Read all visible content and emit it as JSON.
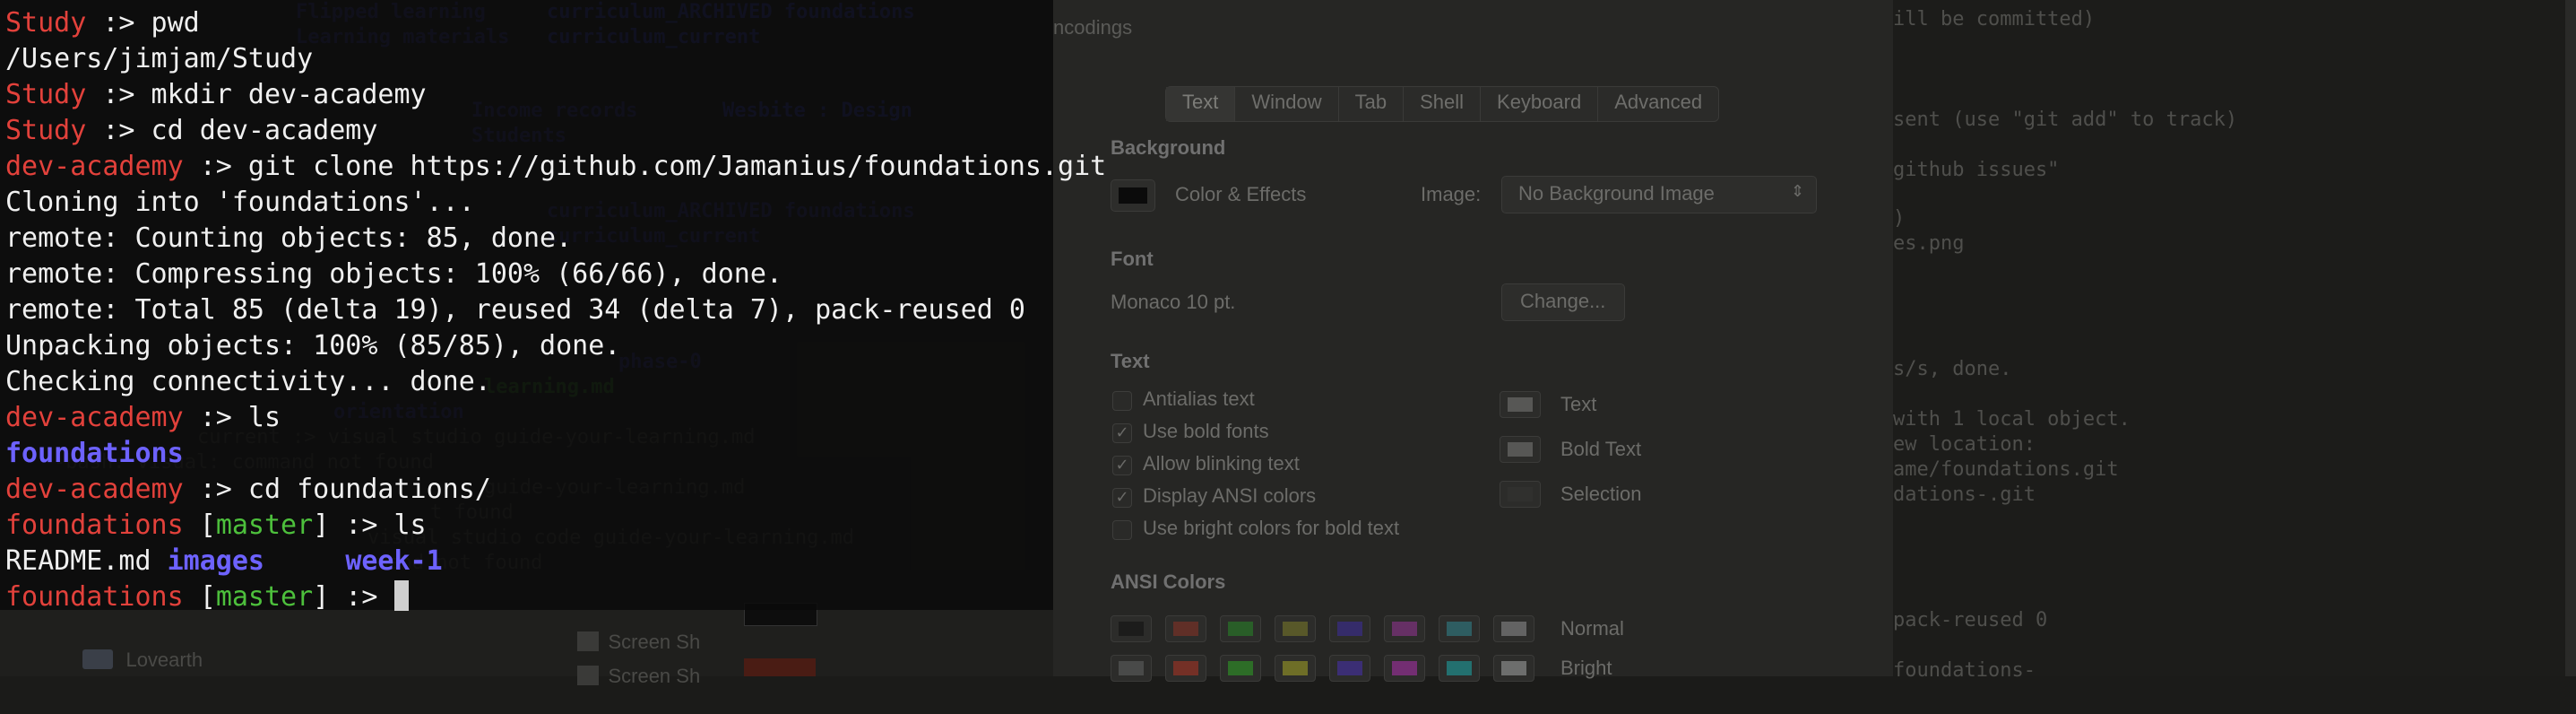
{
  "finder": {
    "rows": [
      {
        "a": "Flipped learning",
        "b": "curriculum_ARCHIVED foundations"
      },
      {
        "a": "Learning materials",
        "b": "curriculum_current"
      },
      {
        "a": "Income records",
        "b": "Wesbite : Design"
      },
      {
        "a": "Students",
        "b": ""
      },
      {
        "a": "curriculum_ARCHIVED foundations",
        "b": ""
      },
      {
        "a": "curriculum_current",
        "b": ""
      },
      {
        "a": "phase-0",
        "b": ""
      },
      {
        "a": "learning.md",
        "b": ""
      },
      {
        "a": "orientation",
        "b": ""
      }
    ],
    "bg_cmds": [
      "current :> visual studio guide-your-learning.md",
      "-bash: visual: command not found",
      "guide-your-learning.md",
      "t found",
      "visual studio code guide-your-learning.md",
      "mand not found"
    ],
    "sidebar_item": "Lovearth",
    "file_items": [
      "Screen Sh",
      "Screen Sh"
    ]
  },
  "prefs": {
    "title_fragment": "ncodings",
    "tabs": [
      "Text",
      "Window",
      "Tab",
      "Shell",
      "Keyboard",
      "Advanced"
    ],
    "background_header": "Background",
    "color_effects": "Color & Effects",
    "image_label": "Image:",
    "image_value": "No Background Image",
    "font_header": "Font",
    "font_value": "Monaco 10 pt.",
    "change_button": "Change...",
    "text_header": "Text",
    "options": [
      {
        "label": "Antialias text",
        "checked": false
      },
      {
        "label": "Use bold fonts",
        "checked": true
      },
      {
        "label": "Allow blinking text",
        "checked": true
      },
      {
        "label": "Display ANSI colors",
        "checked": true
      },
      {
        "label": "Use bright colors for bold text",
        "checked": false
      }
    ],
    "swatches": [
      {
        "label": "Text",
        "color": "#d8d8d8"
      },
      {
        "label": "Bold Text",
        "color": "#d8d8d8"
      },
      {
        "label": "Selection",
        "color": "#3a3a3a"
      }
    ],
    "ansi_header": "ANSI Colors",
    "ansi_normal_label": "Normal",
    "ansi_bright_label": "Bright",
    "ansi_normal": [
      "#000000",
      "#c23621",
      "#25bc24",
      "#adad27",
      "#492ee1",
      "#d338d3",
      "#33bbc8",
      "#cbcccd"
    ],
    "ansi_bright": [
      "#818383",
      "#fc391f",
      "#31e722",
      "#eaec23",
      "#5833ff",
      "#f935f8",
      "#14f0f0",
      "#e9ebeb"
    ]
  },
  "right_term": [
    "ill be committed)",
    "sent (use \"git add\" to track)",
    "github issues\"",
    ")",
    "es.png",
    "s/s, done.",
    "with 1 local object.",
    "ew location:",
    "ame/foundations.git",
    "dations-.git",
    "pack-reused 0",
    "foundations-"
  ],
  "terminal": {
    "lines": [
      [
        {
          "t": "Study",
          "c": "red"
        },
        {
          "t": " :> pwd",
          "c": "w"
        }
      ],
      [
        {
          "t": "/Users/jimjam/Study",
          "c": "w"
        }
      ],
      [
        {
          "t": "Study",
          "c": "red"
        },
        {
          "t": " :> mkdir dev-academy",
          "c": "w"
        }
      ],
      [
        {
          "t": "Study",
          "c": "red"
        },
        {
          "t": " :> cd dev-academy",
          "c": "w"
        }
      ],
      [
        {
          "t": "dev-academy",
          "c": "red"
        },
        {
          "t": " :> git clone https://github.com/Jamanius/foundations.git",
          "c": "w"
        }
      ],
      [
        {
          "t": "Cloning into 'foundations'...",
          "c": "w"
        }
      ],
      [
        {
          "t": "remote: Counting objects: 85, done.",
          "c": "w"
        }
      ],
      [
        {
          "t": "remote: Compressing objects: 100% (66/66), done.",
          "c": "w"
        }
      ],
      [
        {
          "t": "remote: Total 85 (delta 19), reused 34 (delta 7), pack-reused 0",
          "c": "w"
        }
      ],
      [
        {
          "t": "Unpacking objects: 100% (85/85), done.",
          "c": "w"
        }
      ],
      [
        {
          "t": "Checking connectivity... done.",
          "c": "w"
        }
      ],
      [
        {
          "t": "dev-academy",
          "c": "red"
        },
        {
          "t": " :> ls",
          "c": "w"
        }
      ],
      [
        {
          "t": "foundations",
          "c": "blu"
        }
      ],
      [
        {
          "t": "dev-academy",
          "c": "red"
        },
        {
          "t": " :> cd foundations/",
          "c": "w"
        }
      ],
      [
        {
          "t": "foundations",
          "c": "red"
        },
        {
          "t": " [",
          "c": "w"
        },
        {
          "t": "master",
          "c": "grn"
        },
        {
          "t": "] :> ls",
          "c": "w"
        }
      ],
      [
        {
          "t": "README.md ",
          "c": "w"
        },
        {
          "t": "images",
          "c": "blu"
        },
        {
          "t": "     ",
          "c": "w"
        },
        {
          "t": "week-1",
          "c": "blu"
        }
      ],
      [
        {
          "t": "foundations",
          "c": "red"
        },
        {
          "t": " [",
          "c": "w"
        },
        {
          "t": "master",
          "c": "grn"
        },
        {
          "t": "] :> ",
          "c": "w"
        }
      ]
    ],
    "colors": {
      "prompt": "#e2413b",
      "branch": "#4dc03c",
      "dir": "#6d62ff",
      "text": "#f0f0f0"
    }
  }
}
